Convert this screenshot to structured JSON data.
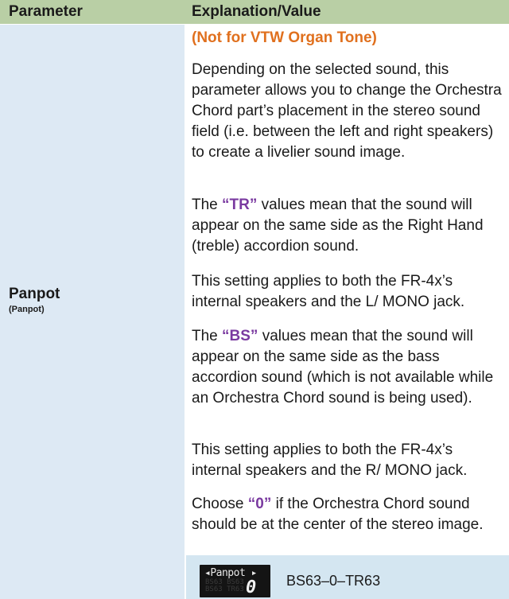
{
  "header": {
    "parameter": "Parameter",
    "explanation": "Explanation/Value"
  },
  "param": {
    "name": "Panpot",
    "sub": "(Panpot)"
  },
  "content": {
    "note": "(Not for VTW Organ Tone)",
    "p1": "Depending on the selected sound, this parameter allows you to change the Orchestra Chord part’s placement in the stereo sound field (i.e. between the left and right speakers) to create a livelier sound image.",
    "p2_pre": "The ",
    "p2_key": "“TR”",
    "p2_post": " values mean that the sound will appear on the same side as the Right Hand (treble) accordion sound.",
    "p3": "This setting applies to both the FR-4x’s internal speakers and the L/ MONO jack.",
    "p4_pre": "The ",
    "p4_key": "“BS”",
    "p4_post": " values mean that the sound will appear on the same side as the bass accordion sound (which is not available while an Orchestra Chord sound is being used).",
    "p5": "This setting applies to both the FR-4x’s internal speakers and the R/ MONO jack.",
    "p6_pre": "Choose ",
    "p6_key": "“0”",
    "p6_post": " if the Orchestra Chord sound should be at the center of the stereo image."
  },
  "display": {
    "title": "◂Panpot ▸",
    "value": "0",
    "ghost1": "BS63 BS63",
    "ghost2": "BS63 TR63",
    "range": "BS63–0–TR63"
  },
  "colors": {
    "header_bg": "#b9cfa5",
    "param_bg": "#dde9f4",
    "note": "#e0701e",
    "highlight": "#7a3aa0"
  }
}
